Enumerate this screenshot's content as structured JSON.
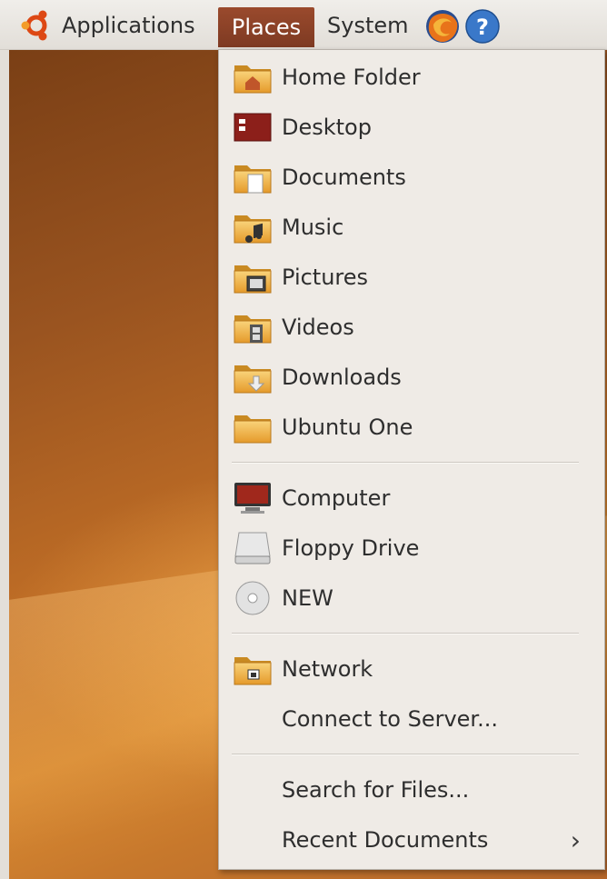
{
  "panel": {
    "applications_label": "Applications",
    "places_label": "Places",
    "system_label": "System",
    "launchers": [
      "firefox-icon",
      "help-icon"
    ]
  },
  "places_menu": {
    "bookmarks": [
      {
        "label": "Home Folder",
        "icon": "home-folder-icon"
      },
      {
        "label": "Desktop",
        "icon": "desktop-icon"
      },
      {
        "label": "Documents",
        "icon": "documents-folder-icon"
      },
      {
        "label": "Music",
        "icon": "music-folder-icon"
      },
      {
        "label": "Pictures",
        "icon": "pictures-folder-icon"
      },
      {
        "label": "Videos",
        "icon": "videos-folder-icon"
      },
      {
        "label": "Downloads",
        "icon": "downloads-folder-icon"
      },
      {
        "label": "Ubuntu One",
        "icon": "folder-icon"
      }
    ],
    "devices": [
      {
        "label": "Computer",
        "icon": "computer-icon"
      },
      {
        "label": "Floppy Drive",
        "icon": "floppy-drive-icon"
      },
      {
        "label": "NEW",
        "icon": "cd-drive-icon"
      }
    ],
    "network": [
      {
        "label": "Network",
        "icon": "network-folder-icon"
      },
      {
        "label": "Connect to Server..."
      }
    ],
    "tools": [
      {
        "label": "Search for Files..."
      },
      {
        "label": "Recent Documents",
        "submenu_arrow": "›"
      }
    ]
  },
  "colors": {
    "panel_active": "#8a4127",
    "folder": "#f0b040",
    "desktop_bg": "#c06e26"
  }
}
